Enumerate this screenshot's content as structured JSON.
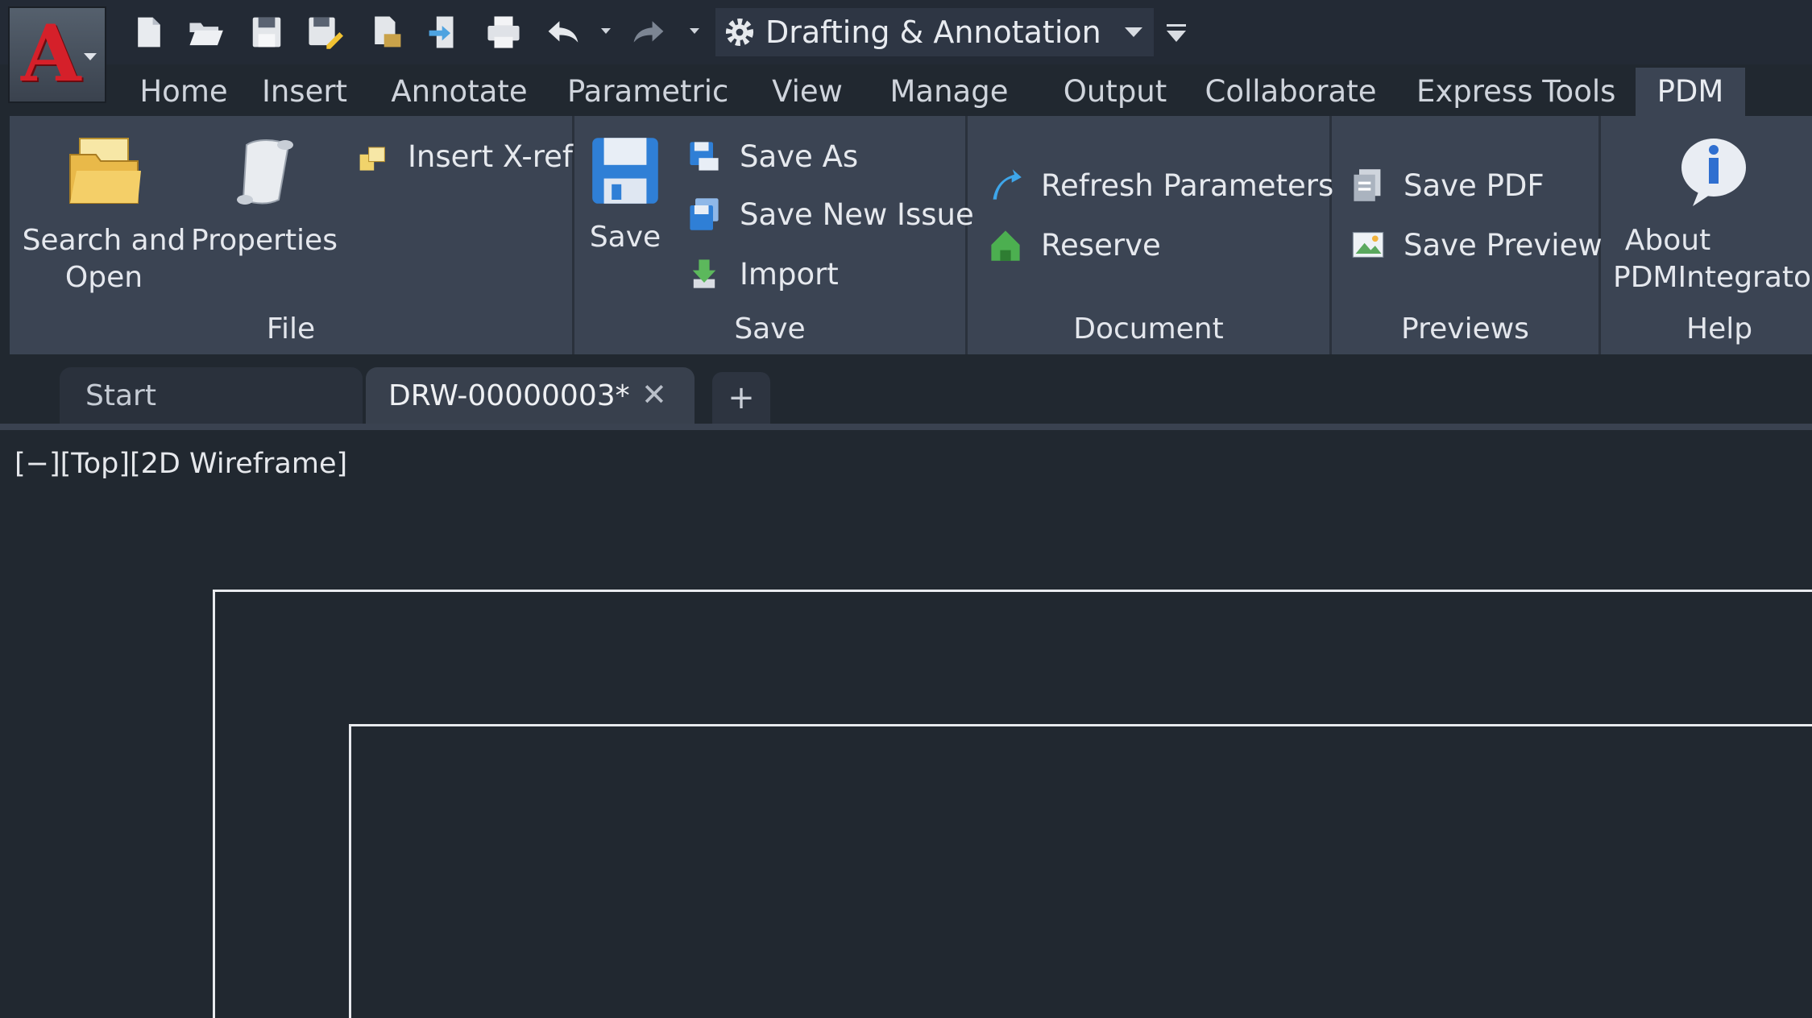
{
  "app": {
    "logo_letter": "A"
  },
  "quick_access": {
    "icons": [
      "new-icon",
      "open-icon",
      "save-icon",
      "save-as-icon",
      "publish-icon",
      "import-icon",
      "plot-icon",
      "undo-icon",
      "redo-icon"
    ],
    "workspace": "Drafting & Annotation"
  },
  "ribbon_tabs": [
    "Home",
    "Insert",
    "Annotate",
    "Parametric",
    "View",
    "Manage",
    "Output",
    "Collaborate",
    "Express Tools",
    "PDM"
  ],
  "ribbon": {
    "file": {
      "title": "File",
      "search_open_line1": "Search and",
      "search_open_line2": "Open",
      "properties": "Properties",
      "insert_xref": "Insert X-ref"
    },
    "save": {
      "title": "Save",
      "save": "Save",
      "save_as": "Save As",
      "save_new_issue": "Save New Issue",
      "import": "Import"
    },
    "document": {
      "title": "Document",
      "refresh_parameters": "Refresh  Parameters",
      "reserve": "Reserve"
    },
    "previews": {
      "title": "Previews",
      "save_pdf": "Save PDF",
      "save_preview": "Save Preview"
    },
    "help": {
      "title": "Help",
      "about_line1": "About",
      "about_line2": "PDMIntegrato"
    }
  },
  "file_tabs": {
    "start": "Start",
    "drawing": "DRW-00000003*",
    "close_glyph": "✕",
    "new_glyph": "+"
  },
  "viewport": {
    "label": "[−][Top][2D Wireframe]"
  },
  "colors": {
    "background": "#212830",
    "ribbon": "#3b4453",
    "accent_red": "#d5202a"
  }
}
